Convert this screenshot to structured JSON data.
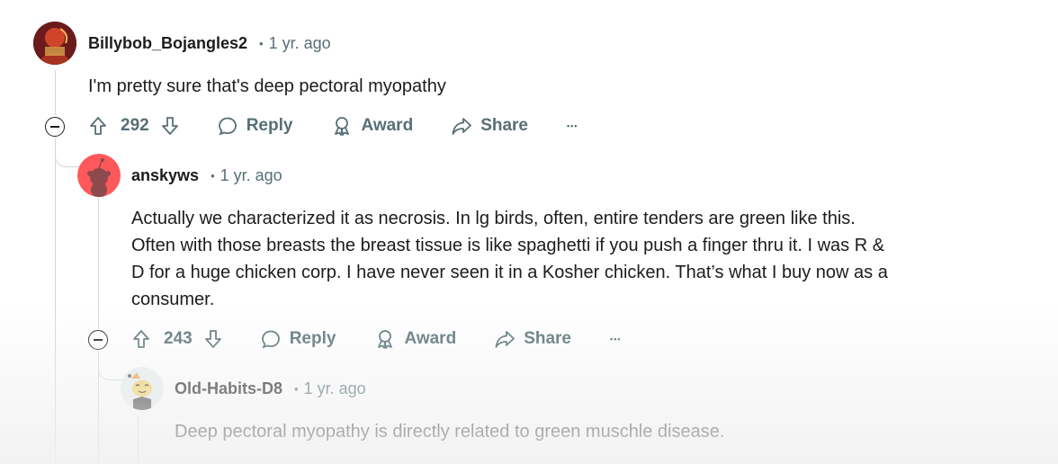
{
  "comments": [
    {
      "username": "Billybob_Bojangles2",
      "time": "1 yr. ago",
      "body": "I'm pretty sure that's deep pectoral myopathy",
      "score": "292",
      "reply_label": "Reply",
      "award_label": "Award",
      "share_label": "Share"
    },
    {
      "username": "anskyws",
      "time": "1 yr. ago",
      "body_lines": [
        "Actually we characterized it as necrosis. In lg birds, often, entire tenders are green like this.",
        "Often with those breasts the breast tissue is like spaghetti if you push a finger thru it. I was R &",
        "D for a huge chicken corp. I have never seen it in a Kosher chicken. That’s what I buy now as a",
        "consumer."
      ],
      "score": "243",
      "reply_label": "Reply",
      "award_label": "Award",
      "share_label": "Share"
    },
    {
      "username": "Old-Habits-D8",
      "time": "1 yr. ago",
      "body": "Deep pectoral myopathy is directly related to green muschle disease."
    }
  ],
  "separator": "•",
  "more_label": "•••",
  "icons": [
    "upvote-icon",
    "downvote-icon",
    "reply-icon",
    "award-icon",
    "share-icon",
    "more-options-icon",
    "collapse-icon"
  ],
  "colors": {
    "text": "#1c1c1c",
    "meta": "#576f76",
    "thread_line": "#d3d6da",
    "avatar2_bg": "#ff585b"
  }
}
